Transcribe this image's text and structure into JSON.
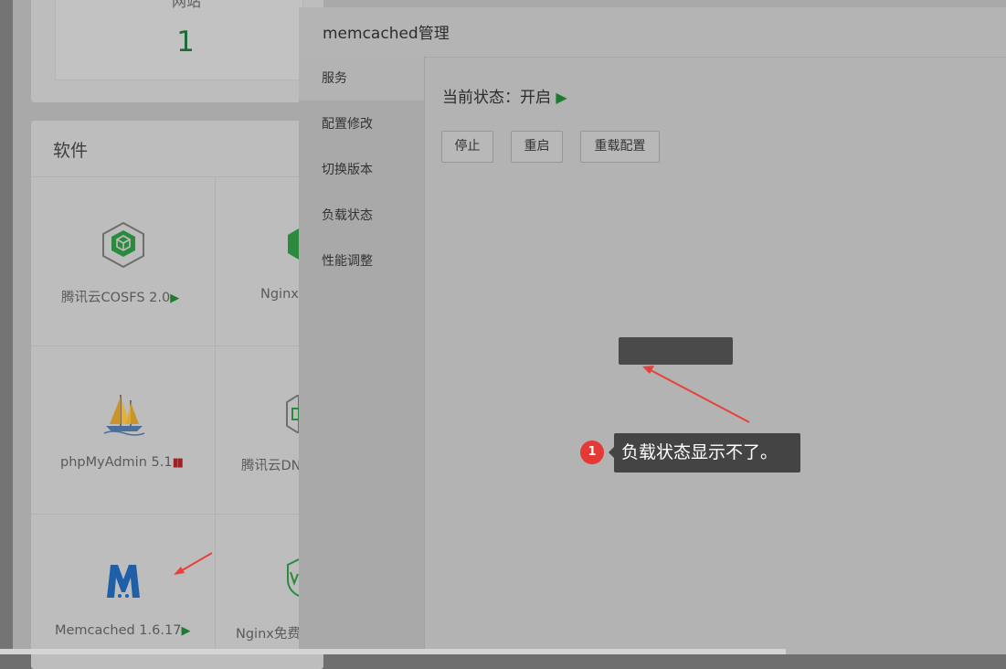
{
  "stats": {
    "label": "网站",
    "value": "1"
  },
  "software": {
    "title": "软件",
    "tiles": [
      {
        "name": "腾讯云COSFS 2.0",
        "status": "running"
      },
      {
        "name": "Nginx",
        "status": "running"
      },
      {
        "name": "phpMyAdmin 5.1",
        "status": "stopped"
      },
      {
        "name": "腾讯云DN",
        "status": ""
      },
      {
        "name": "Memcached 1.6.17",
        "status": "running"
      },
      {
        "name": "Nginx免费",
        "status": ""
      }
    ]
  },
  "modal": {
    "title": "memcached管理",
    "menu": [
      "服务",
      "配置修改",
      "切换版本",
      "负载状态",
      "性能调整"
    ],
    "status_text": "当前状态：开启",
    "buttons": {
      "stop": "停止",
      "restart": "重启",
      "reload": "重载配置"
    }
  },
  "annotation": {
    "number": "1",
    "text": "负载状态显示不了。"
  },
  "colors": {
    "accent_green": "#1f7a31",
    "stopped_red": "#a32020",
    "annotation_red": "#e53935",
    "arrow_red": "#e8403a"
  },
  "icons": [
    "cube-icon",
    "sailboat-icon",
    "memcached-logo-icon",
    "play-icon",
    "pause-icon"
  ]
}
